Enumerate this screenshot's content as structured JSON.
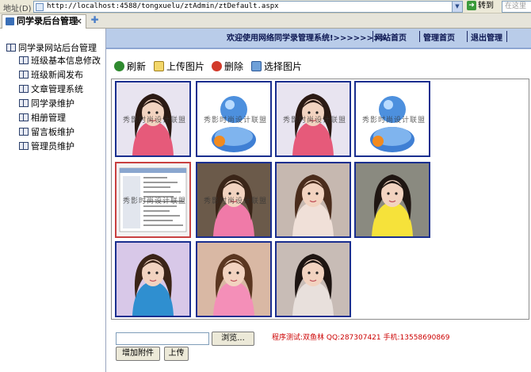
{
  "address_bar": {
    "label": "地址(D)",
    "url": "http://localhost:4588/tongxuelu/ztAdmin/ztDefault.aspx",
    "go_label": "转到",
    "search_placeholder": "在这里"
  },
  "tabs": [
    {
      "label": "同学录后台管理",
      "active": true
    }
  ],
  "sidebar": {
    "root_label": "同学录网站后台管理",
    "items": [
      {
        "label": "班级基本信息修改"
      },
      {
        "label": "班级新闻发布"
      },
      {
        "label": "文章管理系统"
      },
      {
        "label": "同学录维护"
      },
      {
        "label": "相册管理"
      },
      {
        "label": "留言板维护"
      },
      {
        "label": "管理员维护"
      }
    ]
  },
  "header": {
    "welcome": "欢迎使用网络同学录管理系统!>>>>>>>>",
    "links": [
      {
        "label": "网站首页"
      },
      {
        "label": "管理首页"
      },
      {
        "label": "退出管理"
      }
    ]
  },
  "toolbar": {
    "refresh": "刷新",
    "upload": "上传图片",
    "delete": "删除",
    "select": "选择图片"
  },
  "gallery": {
    "watermark": "秀影时尚设计联盟",
    "photos": [
      {
        "kind": "girl",
        "bg": "#e8e4f0",
        "hair": "#2b1a14",
        "shirt": "#e65a7a",
        "watermark": true
      },
      {
        "kind": "msn",
        "bg": "#ffffff",
        "watermark": true
      },
      {
        "kind": "girl",
        "bg": "#e8e4f0",
        "hair": "#2b1a14",
        "shirt": "#e65a7a",
        "watermark": true
      },
      {
        "kind": "msn",
        "bg": "#ffffff",
        "watermark": true
      },
      {
        "kind": "screenshot",
        "bg": "#f4f4f4",
        "watermark": true,
        "selected": true
      },
      {
        "kind": "girl",
        "bg": "#6b5a4a",
        "hair": "#3a2518",
        "shirt": "#f07aa8",
        "watermark": true
      },
      {
        "kind": "girl",
        "bg": "#c6b8b0",
        "hair": "#4a2c1c",
        "shirt": "#f0e0d8",
        "watermark": false
      },
      {
        "kind": "girl",
        "bg": "#8a8a80",
        "hair": "#1f1612",
        "shirt": "#f6e23a",
        "watermark": false
      },
      {
        "kind": "girl",
        "bg": "#d8c8e8",
        "hair": "#3b2417",
        "shirt": "#2f8fd0",
        "watermark": false
      },
      {
        "kind": "girl",
        "bg": "#d9b8a4",
        "hair": "#5a3620",
        "shirt": "#f48fb8",
        "watermark": false
      },
      {
        "kind": "girl",
        "bg": "#c8bcb6",
        "hair": "#1e1512",
        "shirt": "#e8e0dc",
        "watermark": false
      }
    ]
  },
  "upload": {
    "browse_label": "浏览...",
    "add_attachment_label": "增加附件",
    "upload_label": "上传"
  },
  "footer": {
    "contact": "程序测试:双鱼林 QQ:287307421 手机:13558690869"
  },
  "colors": {
    "banner_bg": "#b9cce9",
    "thumb_border": "#1a2f8f",
    "selected_border": "#c84040",
    "contact_text": "#cc0000"
  }
}
